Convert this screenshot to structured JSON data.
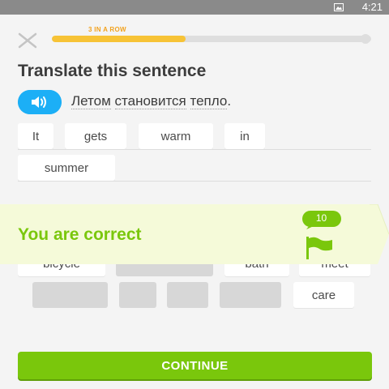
{
  "status_bar": {
    "time": "4:21"
  },
  "header": {
    "streak_label": "3 IN A ROW",
    "progress_fraction": 0.42
  },
  "exercise": {
    "title": "Translate this sentence",
    "prompt_words": [
      "Летом",
      "становится",
      "тепло"
    ],
    "prompt_end": "."
  },
  "answer_tiles": [
    "It",
    "gets",
    "warm",
    "in",
    "summer"
  ],
  "bank_tiles_visible": [
    "bicycle",
    "bath",
    "meet",
    "care"
  ],
  "result": {
    "message": "You are correct",
    "xp": "10"
  },
  "footer": {
    "continue_label": "CONTINUE"
  },
  "colors": {
    "green": "#7ac70c",
    "blue": "#1caff6",
    "orange": "#f2a21e",
    "yellow": "#f7c336",
    "banner": "#f5fad9"
  }
}
